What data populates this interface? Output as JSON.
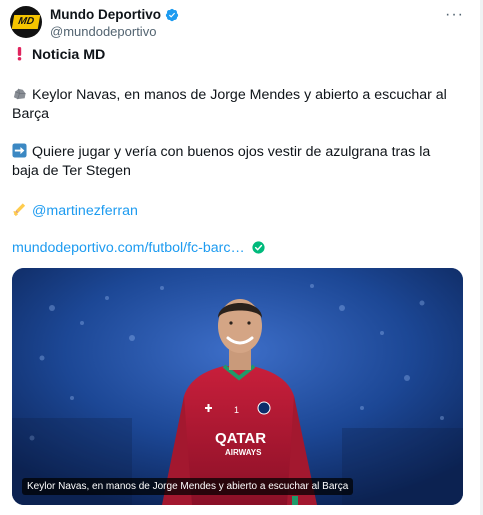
{
  "post": {
    "author_name": "Mundo Deportivo",
    "author_handle": "@mundodeportivo",
    "avatar_text": "MD",
    "more_options": "···",
    "heading": "Noticia MD",
    "line1": "Keylor Navas, en manos de Jorge Mendes y abierto a escuchar al Barça",
    "line2": "Quiere jugar y vería con buenos ojos vestir de azulgrana tras la baja de Ter Stegen",
    "mention": "@martinezferran",
    "link": "mundodeportivo.com/futbol/fc-barc…",
    "media_caption": "Keylor Navas, en manos de Jorge Mendes y abierto a escuchar al Barça",
    "jersey_sponsor_line1": "QATAR",
    "jersey_sponsor_line2": "AIRWAYS",
    "jersey_number": "1"
  },
  "icons": {
    "verified": "verified-badge-icon",
    "alert": "exclamation-icon",
    "rock": "rock-icon",
    "arrow": "right-arrow-icon",
    "writing": "writing-hand-icon",
    "link_check": "check-circle-icon"
  },
  "colors": {
    "accent": "#1d9bf0",
    "verified": "#1d9bf0",
    "alert": "#e0245e",
    "link_check": "#00ba7c",
    "brand": "#f5c400"
  }
}
